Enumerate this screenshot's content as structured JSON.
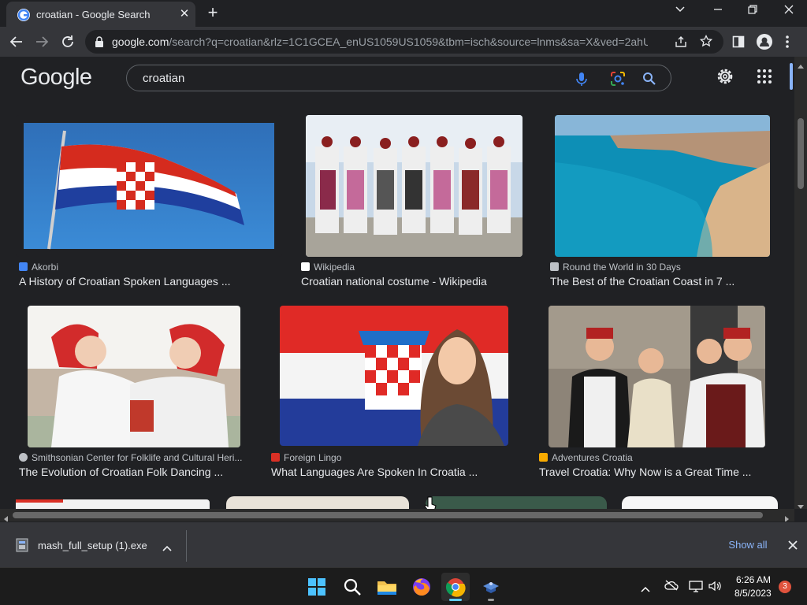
{
  "browser": {
    "tab_title": "croatian - Google Search",
    "url_domain": "google.com",
    "url_rest": "/search?q=croatian&rlz=1C1GCEA_enUS1059US1059&tbm=isch&source=lnms&sa=X&ved=2ahUKE...",
    "tab_close": "✕",
    "new_tab": "+"
  },
  "google": {
    "logo": "Google",
    "query": "croatian"
  },
  "results": [
    {
      "source": "Akorbi",
      "title": "A History of Croatian Spoken Languages ...",
      "src_color": "#4285f4"
    },
    {
      "source": "Wikipedia",
      "title": "Croatian national costume - Wikipedia",
      "src_color": "#ffffff"
    },
    {
      "source": "Round the World in 30 Days",
      "title": "The Best of the Croatian Coast in 7 ...",
      "src_color": "#bdc1c6"
    },
    {
      "source": "Smithsonian Center for Folklife and Cultural Heri...",
      "title": "The Evolution of Croatian Folk Dancing ...",
      "src_color": "#bdc1c6"
    },
    {
      "source": "Foreign Lingo",
      "title": "What Languages Are Spoken In Croatia ...",
      "src_color": "#d93025"
    },
    {
      "source": "Adventures Croatia",
      "title": "Travel Croatia: Why Now is a Great Time ...",
      "src_color": "#f9ab00"
    }
  ],
  "download": {
    "file_name": "mash_full_setup (1).exe",
    "show_all": "Show all"
  },
  "taskbar": {
    "time": "6:26 AM",
    "date": "8/5/2023",
    "notifications": "3"
  }
}
